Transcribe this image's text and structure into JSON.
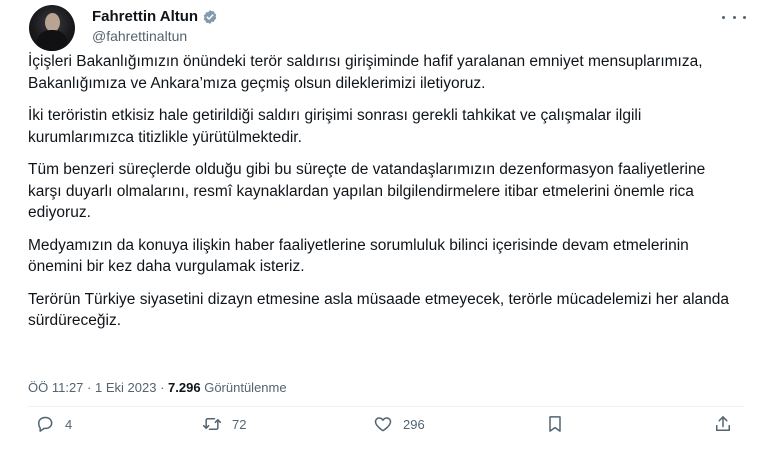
{
  "author": {
    "name": "Fahrettin Altun",
    "handle": "@fahrettinaltun",
    "verified_icon": "verified-badge-icon"
  },
  "tweet": {
    "paragraphs": [
      "İçişleri Bakanlığımızın önündeki terör saldırısı girişiminde hafif yaralanan emniyet mensuplarımıza, Bakanlığımıza ve Ankara’mıza geçmiş olsun dileklerimizi iletiyoruz.",
      "İki teröristin etkisiz hale getirildiği saldırı girişimi sonrası gerekli tahkikat ve çalışmalar ilgili kurumlarımızca titizlikle yürütülmektedir.",
      "Tüm benzeri süreçlerde olduğu gibi bu süreçte de vatandaşlarımızın dezenformasyon faaliyetlerine karşı duyarlı olmalarını, resmî kaynaklardan yapılan bilgilendirmelere itibar etmelerini önemle rica ediyoruz.",
      "Medyamızın da konuya ilişkin haber faaliyetlerine sorumluluk bilinci içerisinde devam etmelerinin önemini bir kez daha vurgulamak isteriz.",
      "Terörün Türkiye siyasetini dizayn etmesine asla müsaade etmeyecek, terörle mücadelemizi her alanda sürdüreceğiz."
    ],
    "time": "ÖÖ 11:27",
    "separator": "·",
    "date": "1 Eki 2023",
    "views_count": "7.296",
    "views_label": "Görüntülenme"
  },
  "actions": {
    "reply_count": "4",
    "retweet_count": "72",
    "like_count": "296"
  },
  "colors": {
    "text": "#0f1419",
    "secondary": "#536471",
    "verified": "#829aab"
  }
}
